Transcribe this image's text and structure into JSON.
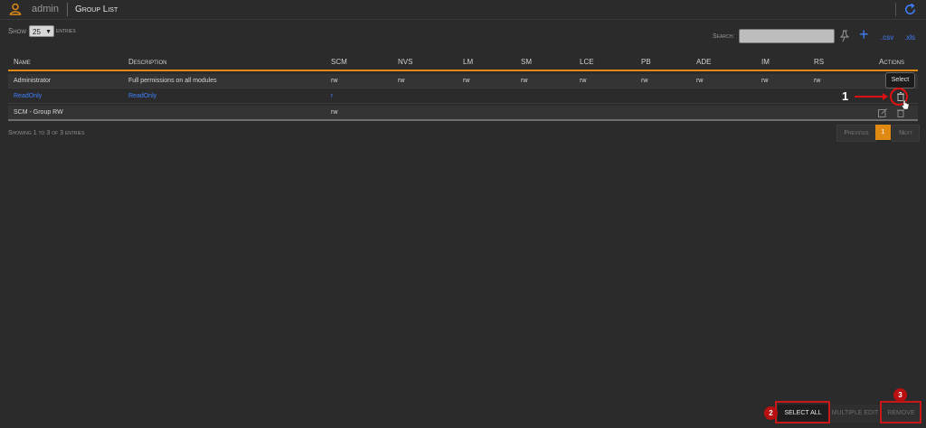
{
  "topbar": {
    "username": "admin",
    "title": "Group List"
  },
  "controls": {
    "show_label": "Show",
    "page_size": "25",
    "entries_label": "entries",
    "search_label": "Search:",
    "search_value": "",
    "csv_label": ".csv",
    "xls_label": ".xls"
  },
  "table": {
    "headers": [
      "Name",
      "Description",
      "SCM",
      "NVS",
      "LM",
      "SM",
      "LCE",
      "PB",
      "ADE",
      "IM",
      "RS",
      "Actions"
    ],
    "rows": [
      {
        "name": "Administrator",
        "description": "Full permissions on all modules",
        "scm": "rw",
        "nvs": "rw",
        "lm": "rw",
        "sm": "rw",
        "lce": "rw",
        "pb": "rw",
        "ade": "rw",
        "im": "rw",
        "rs": "rw"
      },
      {
        "name": "ReadOnly",
        "description": "ReadOnly",
        "scm": "r",
        "nvs": "",
        "lm": "",
        "sm": "",
        "lce": "",
        "pb": "",
        "ade": "",
        "im": "",
        "rs": ""
      },
      {
        "name": "SCM - Group RW",
        "description": "",
        "scm": "rw",
        "nvs": "",
        "lm": "",
        "sm": "",
        "lce": "",
        "pb": "",
        "ade": "",
        "im": "",
        "rs": ""
      }
    ]
  },
  "tooltip": "Select",
  "annotations": {
    "one": "1",
    "two": "2",
    "three": "3"
  },
  "info": "Showing 1 to 3 of 3 entries",
  "pagination": {
    "previous": "Previous",
    "current": "1",
    "next": "Next"
  },
  "buttons": {
    "select_all": "SELECT ALL",
    "multiple_edit": "MULTIPLE EDIT",
    "remove": "REMOVE"
  },
  "colors": {
    "accent": "#e08a14",
    "link": "#3f7fff",
    "annotation": "#c81818",
    "background": "#2b2b2b"
  },
  "icons": [
    "user-icon",
    "refresh-icon",
    "pin-icon",
    "add-icon",
    "delete-icon",
    "edit-icon",
    "cursor-icon"
  ]
}
